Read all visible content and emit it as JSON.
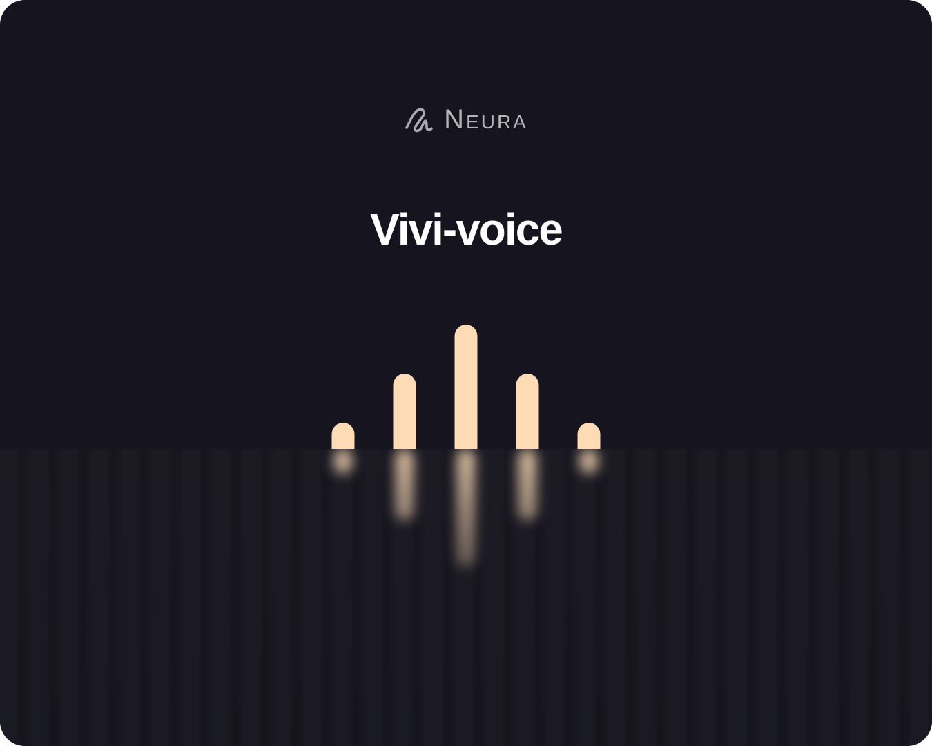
{
  "brand": {
    "name": "Neura",
    "icon": "neura-logo-icon"
  },
  "title": "Vivi-voice",
  "voice_visualizer": {
    "icon": "waveform-icon",
    "bar_color": "#fddcb5",
    "levels": [
      0.2,
      0.6,
      1.0,
      0.6,
      0.2
    ]
  },
  "colors": {
    "background": "#15141f",
    "title": "#ffffff",
    "brand_text": "#b5b5bc"
  }
}
